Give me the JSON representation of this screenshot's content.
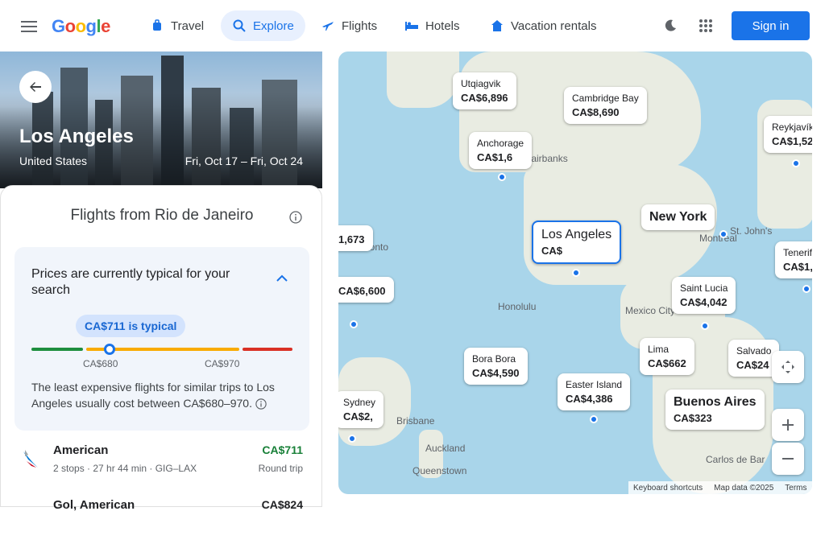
{
  "header": {
    "logo": [
      "G",
      "o",
      "o",
      "g",
      "l",
      "e"
    ],
    "tabs": [
      {
        "label": "Travel",
        "icon": "travel-icon"
      },
      {
        "label": "Explore",
        "icon": "explore-icon"
      },
      {
        "label": "Flights",
        "icon": "flights-icon"
      },
      {
        "label": "Hotels",
        "icon": "hotels-icon"
      },
      {
        "label": "Vacation rentals",
        "icon": "vacation-rentals-icon"
      }
    ],
    "sign_in": "Sign in"
  },
  "hero": {
    "city": "Los Angeles",
    "country": "United States",
    "dates": "Fri, Oct 17 – Fri, Oct 24"
  },
  "panel": {
    "title": "Flights from Rio de Janeiro",
    "insight_prefix": "Prices are currently ",
    "insight_level": "typical",
    "insight_suffix": " for your search",
    "typical_pill": "CA$711 is typical",
    "range_low": "CA$680",
    "range_high": "CA$970",
    "current_price_fraction": 0.3,
    "footnote": "The least expensive flights for similar trips to Los Angeles usually cost between CA$680–970."
  },
  "flights": [
    {
      "airline": "American",
      "detail": "2 stops · 27 hr 44 min · GIG–LAX",
      "price": "CA$711",
      "type": "Round trip"
    },
    {
      "airline": "Gol, American",
      "detail": "",
      "price": "CA$824",
      "type": ""
    }
  ],
  "map": {
    "bubbles": [
      {
        "city": "Utqiagvik",
        "price": "CA$6,896"
      },
      {
        "city": "Cambridge Bay",
        "price": "CA$8,690"
      },
      {
        "city": "Anchorage",
        "price": "CA$1,6"
      },
      {
        "city": "Reykjavík",
        "price": "CA$1,52"
      },
      {
        "city": "New York",
        "price": ""
      },
      {
        "city": "Los Angeles",
        "price": "CA$"
      },
      {
        "city": "Tenerif",
        "price": "CA$1,"
      },
      {
        "city": "Saint Lucia",
        "price": "CA$4,042"
      },
      {
        "city": "Lima",
        "price": "CA$662"
      },
      {
        "city": "Salvado",
        "price": "CA$24"
      },
      {
        "city": "Bora Bora",
        "price": "CA$4,590"
      },
      {
        "city": "Easter Island",
        "price": "CA$4,386"
      },
      {
        "city": "Buenos Aires",
        "price": "CA$323"
      },
      {
        "city": "Sydney",
        "price": "CA$2,"
      },
      {
        "city": "",
        "price": "CA$6,600"
      },
      {
        "city": "",
        "price": "1,673"
      }
    ],
    "labels": [
      "Fairbanks",
      "Honolulu",
      "Mexico City",
      "St. John's",
      "Auckland",
      "Queenstown",
      "Carlos de Bar",
      "Brisbane",
      "Toronto",
      "Montreal"
    ],
    "attribution": [
      "Keyboard shortcuts",
      "Map data ©2025",
      "Terms"
    ]
  }
}
